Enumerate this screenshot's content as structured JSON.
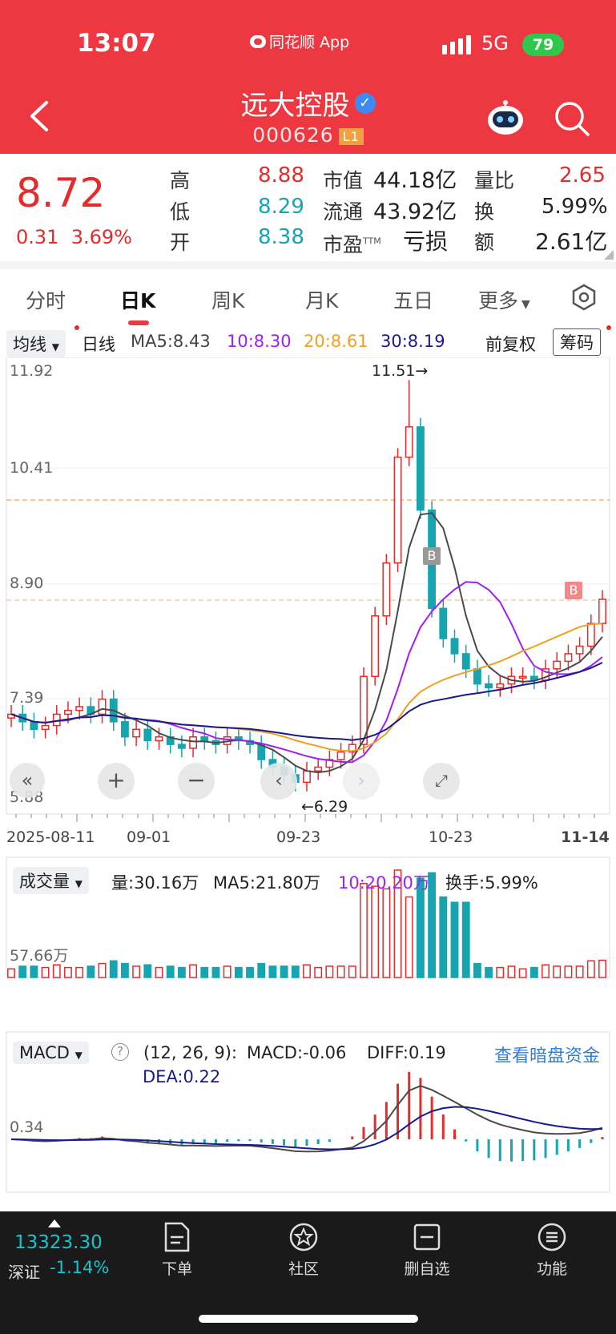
{
  "status": {
    "time": "13:07",
    "app": "同花顺 App",
    "network": "5G",
    "battery": "79"
  },
  "header": {
    "name": "远大控股",
    "code": "000626",
    "level": "L1"
  },
  "quote": {
    "price": "8.72",
    "change": "0.31",
    "change_pct": "3.69%",
    "high_label": "高",
    "high": "8.88",
    "low_label": "低",
    "low": "8.29",
    "open_label": "开",
    "open": "8.38",
    "mktcap_label": "市值",
    "mktcap": "44.18亿",
    "float_label": "流通",
    "float": "43.92亿",
    "pe_label": "市盈",
    "pe_sup": "TTM",
    "pe": "亏损",
    "volratio_label": "量比",
    "volratio": "2.65",
    "turnover_label": "换",
    "turnover": "5.99%",
    "amount_label": "额",
    "amount": "2.61亿"
  },
  "tabs": [
    "分时",
    "日K",
    "周K",
    "月K",
    "五日",
    "更多"
  ],
  "toolbar": {
    "ma_btn": "均线",
    "period": "日线",
    "ma5": "MA5:8.43",
    "ma10": "10:8.30",
    "ma20": "20:8.61",
    "ma30": "30:8.19",
    "adjust": "前复权",
    "chips": "筹码"
  },
  "price_axis": [
    "11.92",
    "10.41",
    "8.90",
    "7.39",
    "5.88"
  ],
  "annotations": {
    "high": "11.51→",
    "low": "←6.29",
    "b1": "B",
    "b2": "B"
  },
  "date_axis": [
    "2025-08-11",
    "09-01",
    "09-23",
    "10-23",
    "11-14"
  ],
  "volume": {
    "btn": "成交量",
    "vol": "量:30.16万",
    "ma5": "MA5:21.80万",
    "ma10": "10:20.20万",
    "turnover": "换手:5.99%",
    "axis": "57.66万"
  },
  "macd": {
    "btn": "MACD",
    "help": "?",
    "params": "(12, 26, 9):",
    "macd": "MACD:-0.06",
    "diff": "DIFF:0.19",
    "dea": "DEA:0.22",
    "link": "查看暗盘资金",
    "axis": "0.34"
  },
  "nav": {
    "index_value": "13323.30",
    "index_name": "深证",
    "index_change": "-1.14%",
    "order": "下单",
    "community": "社区",
    "remove_watch": "删自选",
    "functions": "功能"
  },
  "colors": {
    "up": "#e62b2b",
    "down": "#16a5b0",
    "brand": "#ee3841",
    "ma5": "#4a4a4a",
    "ma10": "#a020f0",
    "ma20": "#f0a020",
    "ma30": "#1a1a8c"
  },
  "chart_data": {
    "type": "candlestick",
    "price_range": [
      5.88,
      11.92
    ],
    "x_labels": [
      "2025-08-11",
      "09-01",
      "09-23",
      "10-23",
      "11-14"
    ],
    "close_series": [
      7.2,
      7.1,
      7.0,
      7.05,
      7.2,
      7.25,
      7.3,
      7.2,
      7.4,
      7.1,
      6.9,
      7.0,
      6.85,
      6.9,
      6.8,
      6.75,
      6.9,
      6.85,
      6.8,
      6.9,
      6.85,
      6.8,
      6.6,
      6.5,
      6.4,
      6.3,
      6.45,
      6.5,
      6.6,
      6.7,
      6.8,
      7.7,
      8.5,
      9.2,
      10.6,
      11.0,
      9.9,
      8.6,
      8.2,
      8.0,
      7.8,
      7.6,
      7.55,
      7.6,
      7.7,
      7.7,
      7.65,
      7.8,
      7.9,
      8.0,
      8.1,
      8.4,
      8.72
    ],
    "high": 11.51,
    "low": 6.29
  }
}
